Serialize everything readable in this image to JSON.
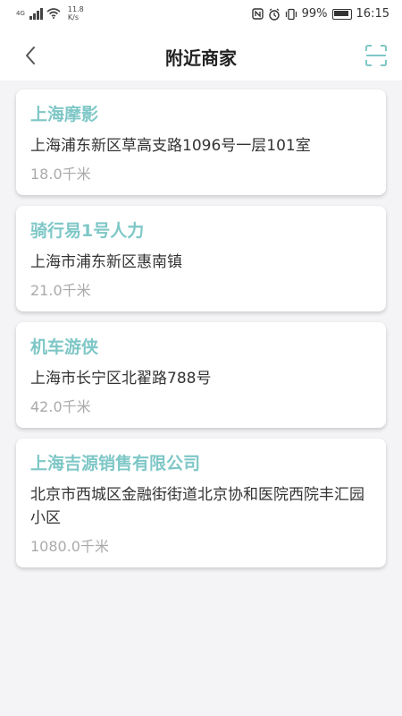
{
  "status_bar": {
    "network_label": "4G",
    "speed_value": "11.8",
    "speed_unit": "K/s",
    "battery_percent": "99%",
    "time": "16:15"
  },
  "nav": {
    "title": "附近商家"
  },
  "merchants": [
    {
      "name": "上海摩影",
      "address": "上海浦东新区草高支路1096号一层101室",
      "distance": "18.0千米"
    },
    {
      "name": "骑行易1号人力",
      "address": "上海市浦东新区惠南镇",
      "distance": "21.0千米"
    },
    {
      "name": "机车游侠",
      "address": "上海市长宁区北翟路788号",
      "distance": "42.0千米"
    },
    {
      "name": "上海吉源销售有限公司",
      "address": "北京市西城区金融街街道北京协和医院西院丰汇园小区",
      "distance": "1080.0千米"
    }
  ],
  "colors": {
    "accent": "#7fc7c7",
    "background": "#f4f4f6"
  },
  "icons": {
    "back": "chevron-left-icon",
    "scan": "scan-icon"
  }
}
